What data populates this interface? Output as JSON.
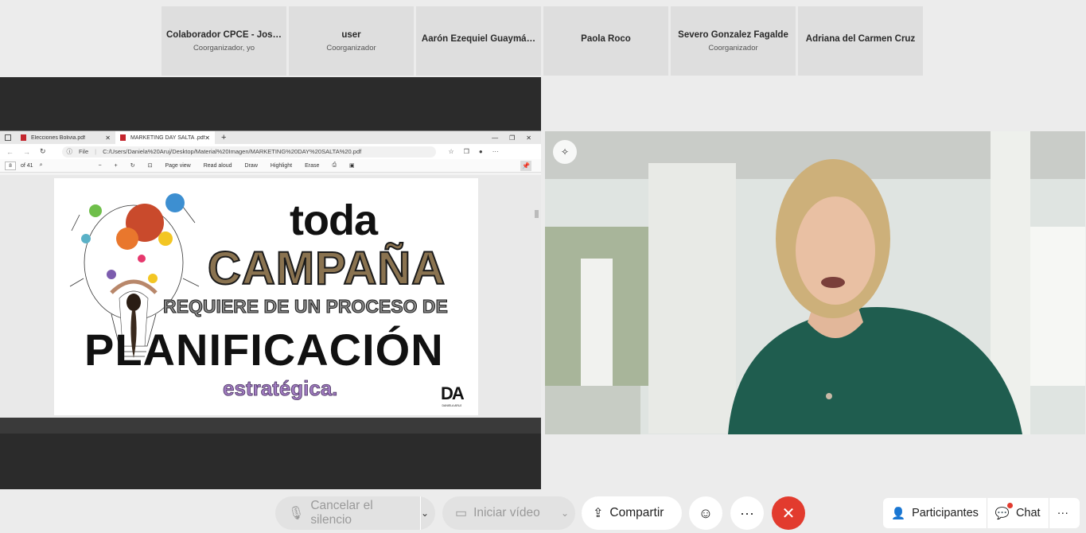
{
  "participants": [
    {
      "name": "Colaborador CPCE - Jos…",
      "role": "Coorganizador, yo"
    },
    {
      "name": "user",
      "role": "Coorganizador"
    },
    {
      "name": "Aarón Ezequiel Guaymá…",
      "role": ""
    },
    {
      "name": "Paola Roco",
      "role": ""
    },
    {
      "name": "Severo Gonzalez Fagalde",
      "role": "Coorganizador"
    },
    {
      "name": "Adriana del Carmen Cruz",
      "role": ""
    }
  ],
  "browser": {
    "tabs": [
      {
        "label": "Elecciones Bolivia.pdf"
      },
      {
        "label": "MARKETING DAY SALTA .pdf"
      }
    ],
    "url_prefix": "File",
    "url": "C:/Users/Daniela%20Aruj/Desktop/Material%20Imagen/MARKETING%20DAY%20SALTA%20.pdf",
    "pdf": {
      "page": "8",
      "of": "of 41",
      "page_view": "Page view",
      "read_aloud": "Read aloud",
      "draw": "Draw",
      "highlight": "Highlight",
      "erase": "Erase"
    }
  },
  "slide": {
    "line1": "toda",
    "line2": "CAMPAÑA",
    "line3": "REQUIERE DE UN PROCESO DE",
    "line4": "PLANIFICACIÓN",
    "line5": "estratégica.",
    "logo": "DA",
    "logo_sub": "DANIELA ARUJ"
  },
  "controls": {
    "mute": "Cancelar el silencio",
    "video": "Iniciar vídeo",
    "share": "Compartir",
    "participants": "Participantes",
    "chat": "Chat"
  },
  "colors": {
    "hangup": "#e23b2e",
    "campana": "#8a7350",
    "estrategica": "#a07bc0"
  }
}
